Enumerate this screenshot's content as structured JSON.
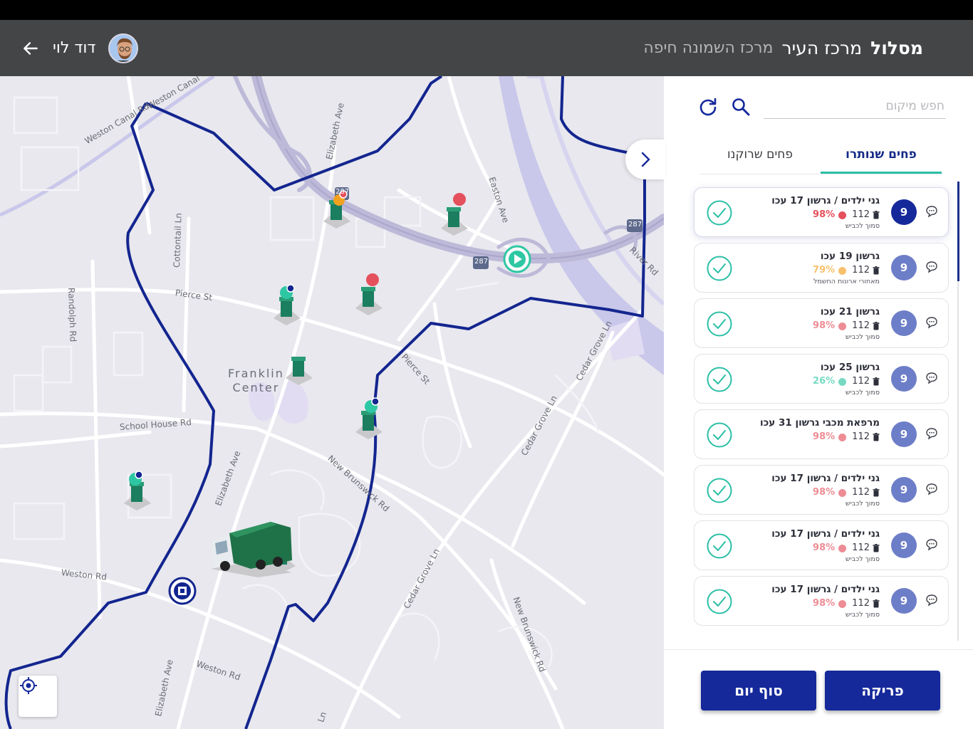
{
  "header": {
    "route_word": "מסלול",
    "route_name": "מרכז העיר",
    "route_sub": "מרכז השמונה חיפה",
    "user_name": "דוד לוי"
  },
  "map": {
    "streets": {
      "weston_canal": "Weston Canal Rd",
      "weston_canal2": "Weston Canal",
      "elizabeth_top": "Elizabeth Ave",
      "easton": "Easton Ave",
      "cottontail": "Cottontail Ln",
      "randolph": "Randolph Rd",
      "pierce_west": "Pierce St",
      "pierce_east": "Pierce St",
      "school_house": "School House Rd",
      "elizabeth_mid": "Elizabeth Ave",
      "new_brunswick_mid": "New Brunswick Rd",
      "cedar_grove_1": "Cedar Grove Ln",
      "cedar_grove_2": "Cedar Grove Ln",
      "cedar_grove_3": "Cedar Grove Ln",
      "river_rd": "River Rd",
      "weston_rd_1": "Weston Rd",
      "weston_rd_2": "Weston Rd",
      "elizabeth_bottom": "Elizabeth Ave",
      "new_brunswick_bottom": "New Brunswick Rd",
      "ln_bottom": "Ln",
      "i287_a": "287",
      "i287_b": "287",
      "i287_c": "287"
    },
    "city": {
      "line1": "Franklin",
      "line2": "Center"
    },
    "colors": {
      "route": "#13258f",
      "full": "#e4505c",
      "mid": "#f4a11f",
      "low": "#2ec7a3",
      "accent": "#15299b"
    }
  },
  "panel": {
    "search": {
      "placeholder": "חפש מיקום"
    },
    "tabs": {
      "active": "פחים שנותרו",
      "inactive": "פחים שרוקנו"
    },
    "bins": [
      {
        "address": "גני ילדים / גרשון 17 עכו",
        "badge": "9",
        "count": "112",
        "pct": "98%",
        "note": "סמוך לכביש",
        "color": "#e4505c"
      },
      {
        "address": "גרשון 19 עכו",
        "badge": "9",
        "count": "112",
        "pct": "79%",
        "note": "מאחורי ארונות החשמל",
        "color": "#f4a11f"
      },
      {
        "address": "גרשון 21 עכו",
        "badge": "9",
        "count": "112",
        "pct": "98%",
        "note": "סמוך לכביש",
        "color": "#e4505c"
      },
      {
        "address": "גרשון 25 עכו",
        "badge": "9",
        "count": "112",
        "pct": "26%",
        "note": "סמוך לכביש",
        "color": "#2ec7a3"
      },
      {
        "address": "מרפאת מכבי גרשון 31 עכו",
        "badge": "9",
        "count": "112",
        "pct": "98%",
        "note": "",
        "color": "#e4505c"
      },
      {
        "address": "גני ילדים / גרשון 17 עכו",
        "badge": "9",
        "count": "112",
        "pct": "98%",
        "note": "סמוך לכביש",
        "color": "#e4505c"
      },
      {
        "address": "גני ילדים / גרשון 17 עכו",
        "badge": "9",
        "count": "112",
        "pct": "98%",
        "note": "סמוך לכביש",
        "color": "#e4505c"
      },
      {
        "address": "גני ילדים / גרשון 17 עכו",
        "badge": "9",
        "count": "112",
        "pct": "98%",
        "note": "סמוך לכביש",
        "color": "#e4505c"
      }
    ]
  },
  "footer": {
    "unload_label": "פריקה",
    "end_day_label": "סוף יום"
  }
}
